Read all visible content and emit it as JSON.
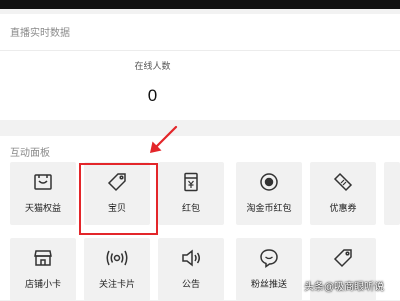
{
  "live_panel": {
    "title": "直播实时数据",
    "online_label": "在线人数",
    "online_value": "0"
  },
  "interact_panel": {
    "title": "互动面板",
    "tiles": [
      {
        "label": "天猫权益",
        "icon": "tmall-box-icon"
      },
      {
        "label": "宝贝",
        "icon": "tag-icon"
      },
      {
        "label": "红包",
        "icon": "red-envelope-icon"
      },
      {
        "label": "淘金币红包",
        "icon": "gold-coin-icon"
      },
      {
        "label": "优惠券",
        "icon": "coupon-icon"
      },
      {
        "label": "",
        "icon": ""
      },
      {
        "label": "店铺小卡",
        "icon": "shop-card-icon"
      },
      {
        "label": "关注卡片",
        "icon": "broadcast-icon"
      },
      {
        "label": "公告",
        "icon": "speaker-icon"
      },
      {
        "label": "粉丝推送",
        "icon": "chat-bubble-icon"
      },
      {
        "label": "",
        "icon": "tag-icon"
      }
    ]
  },
  "watermark": "头条@吸商眼听说",
  "colors": {
    "highlight": "#e3262a",
    "tile_bg": "#f1f1f1",
    "page_bg": "#f2f2f2"
  }
}
